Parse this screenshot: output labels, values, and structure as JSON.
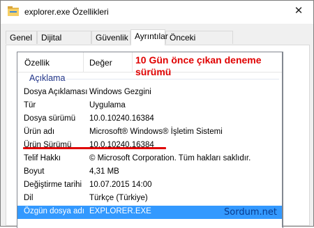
{
  "window": {
    "title": "explorer.exe Özellikleri",
    "close_glyph": "✕"
  },
  "tabs": [
    {
      "label": "Genel"
    },
    {
      "label": "Dijital İmzalar"
    },
    {
      "label": "Güvenlik"
    },
    {
      "label": "Ayrıntılar"
    },
    {
      "label": "Önceki Sürümler"
    }
  ],
  "active_tab": "Ayrıntılar",
  "list": {
    "columns": {
      "property": "Özellik",
      "value": "Değer"
    },
    "group": "Açıklama",
    "rows": [
      {
        "key": "Dosya Açıklaması",
        "value": "Windows Gezgini"
      },
      {
        "key": "Tür",
        "value": "Uygulama"
      },
      {
        "key": "Dosya sürümü",
        "value": "10.0.10240.16384"
      },
      {
        "key": "Ürün adı",
        "value": "Microsoft® Windows® İşletim Sistemi"
      },
      {
        "key": "Ürün Sürümü",
        "value": "10.0.10240.16384"
      },
      {
        "key": "Telif Hakkı",
        "value": "© Microsoft Corporation. Tüm hakları saklıdır."
      },
      {
        "key": "Boyut",
        "value": "4,31 MB"
      },
      {
        "key": "Değiştirme tarihi",
        "value": "10.07.2015 14:00"
      },
      {
        "key": "Dil",
        "value": "Türkçe (Türkiye)"
      },
      {
        "key": "Özgün dosya adı",
        "value": "EXPLORER.EXE"
      }
    ]
  },
  "annotation": {
    "text_line1": "10 Gün önce çıkan deneme",
    "text_line2": "sürümü",
    "color": "#e00000"
  },
  "watermark": "Sordum.net",
  "colors": {
    "selection": "#3399ff",
    "group_header": "#1e3287"
  }
}
